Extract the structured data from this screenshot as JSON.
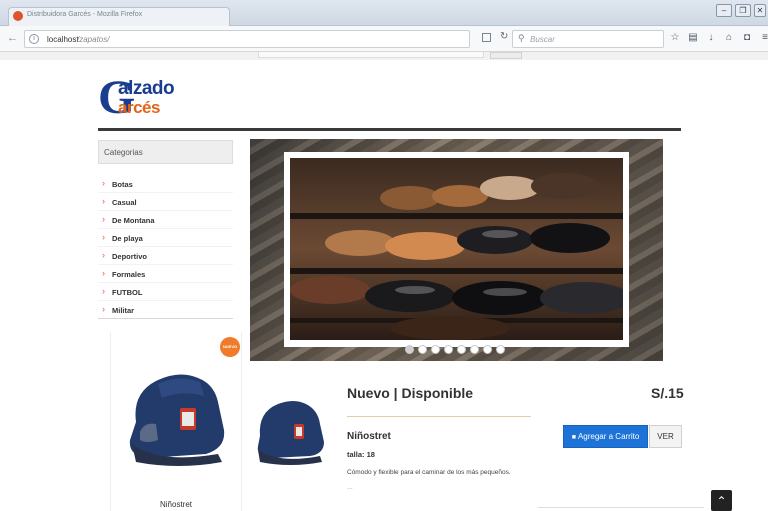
{
  "browser": {
    "tab_title": "Distribuidora Garcés - Mozilla Firefox",
    "url_host": "localhost",
    "url_path": "/zapatos/",
    "search_placeholder": "Buscar",
    "window_buttons": [
      "minimize-icon",
      "restore-icon",
      "close-icon"
    ],
    "toolbar_icons": [
      "star-icon",
      "reading-list-icon",
      "download-icon",
      "home-icon",
      "pocket-icon",
      "menu-icon"
    ]
  },
  "logo": {
    "letter": "G",
    "top": "alzado",
    "bottom": "arcés"
  },
  "sidebar": {
    "heading": "Categorias",
    "items": [
      {
        "label": "Botas"
      },
      {
        "label": "Casual"
      },
      {
        "label": "De Montana"
      },
      {
        "label": "De playa"
      },
      {
        "label": "Deportivo"
      },
      {
        "label": "Formales"
      },
      {
        "label": "FUTBOL"
      },
      {
        "label": "Militar"
      }
    ]
  },
  "carousel": {
    "slides": 8,
    "active_index": 0
  },
  "product_card": {
    "badge": "NUEVO",
    "name": "Niñostret"
  },
  "product": {
    "title": "Nuevo | Disponible",
    "price": "S/.15",
    "name": "Niñostret",
    "size": "talla: 18",
    "description": "Cómodo y flexible para el caminar de los más pequeños.",
    "ellipsis": "...",
    "add_to_cart": "Agregar a Carrito",
    "view": "VER"
  },
  "colors": {
    "brand_blue": "#1a3d8f",
    "brand_orange": "#e0641a",
    "button_blue": "#1e73d8",
    "chevron": "#e05a3a"
  }
}
